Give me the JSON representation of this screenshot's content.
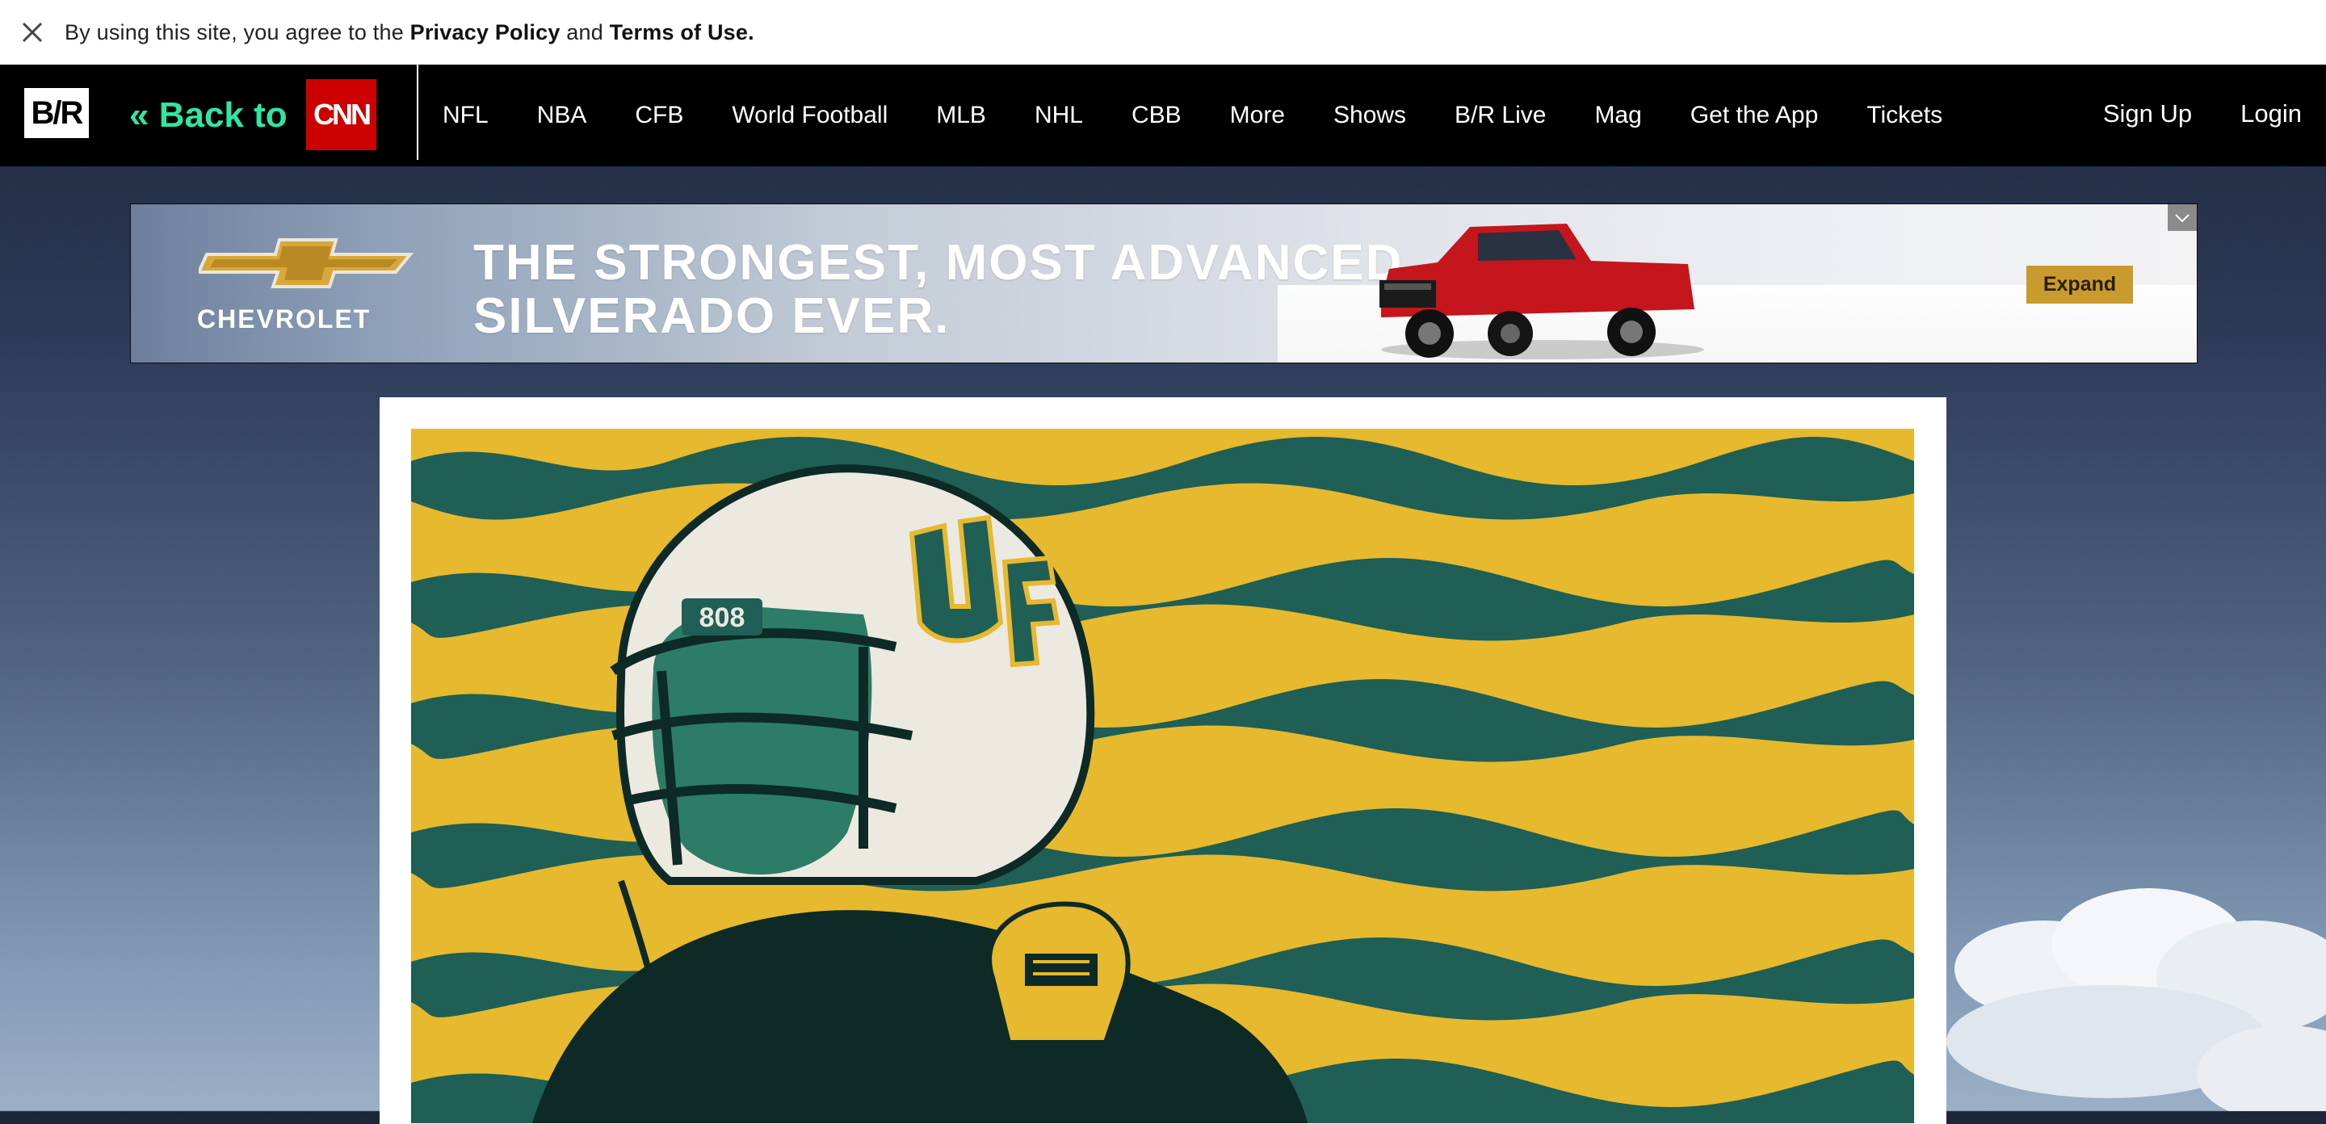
{
  "consent": {
    "prefix": "By using this site, you agree to the ",
    "privacy_link": "Privacy Policy",
    "middle": " and ",
    "terms_link": "Terms of Use."
  },
  "nav": {
    "logo_text": "B/R",
    "back_to": "« Back to",
    "cnn_text": "CNN",
    "links": [
      "NFL",
      "NBA",
      "CFB",
      "World Football",
      "MLB",
      "NHL",
      "CBB",
      "More",
      "Shows",
      "B/R Live",
      "Mag",
      "Get the App",
      "Tickets"
    ],
    "sign_up": "Sign Up",
    "login": "Login"
  },
  "ad": {
    "brand": "CHEVROLET",
    "headline_line1": "THE STRONGEST, MOST ADVANCED",
    "headline_line2": "SILVERADO EVER.",
    "expand_label": "Expand",
    "colors": {
      "expand_bg": "#c99a2e",
      "brand_gold": "#d8a93a",
      "truck": "#c4161c"
    }
  },
  "hero": {
    "helmet_number": "808",
    "colors": {
      "yellow": "#e6b92e",
      "green": "#1f5f55",
      "dark": "#0d2a26"
    }
  }
}
